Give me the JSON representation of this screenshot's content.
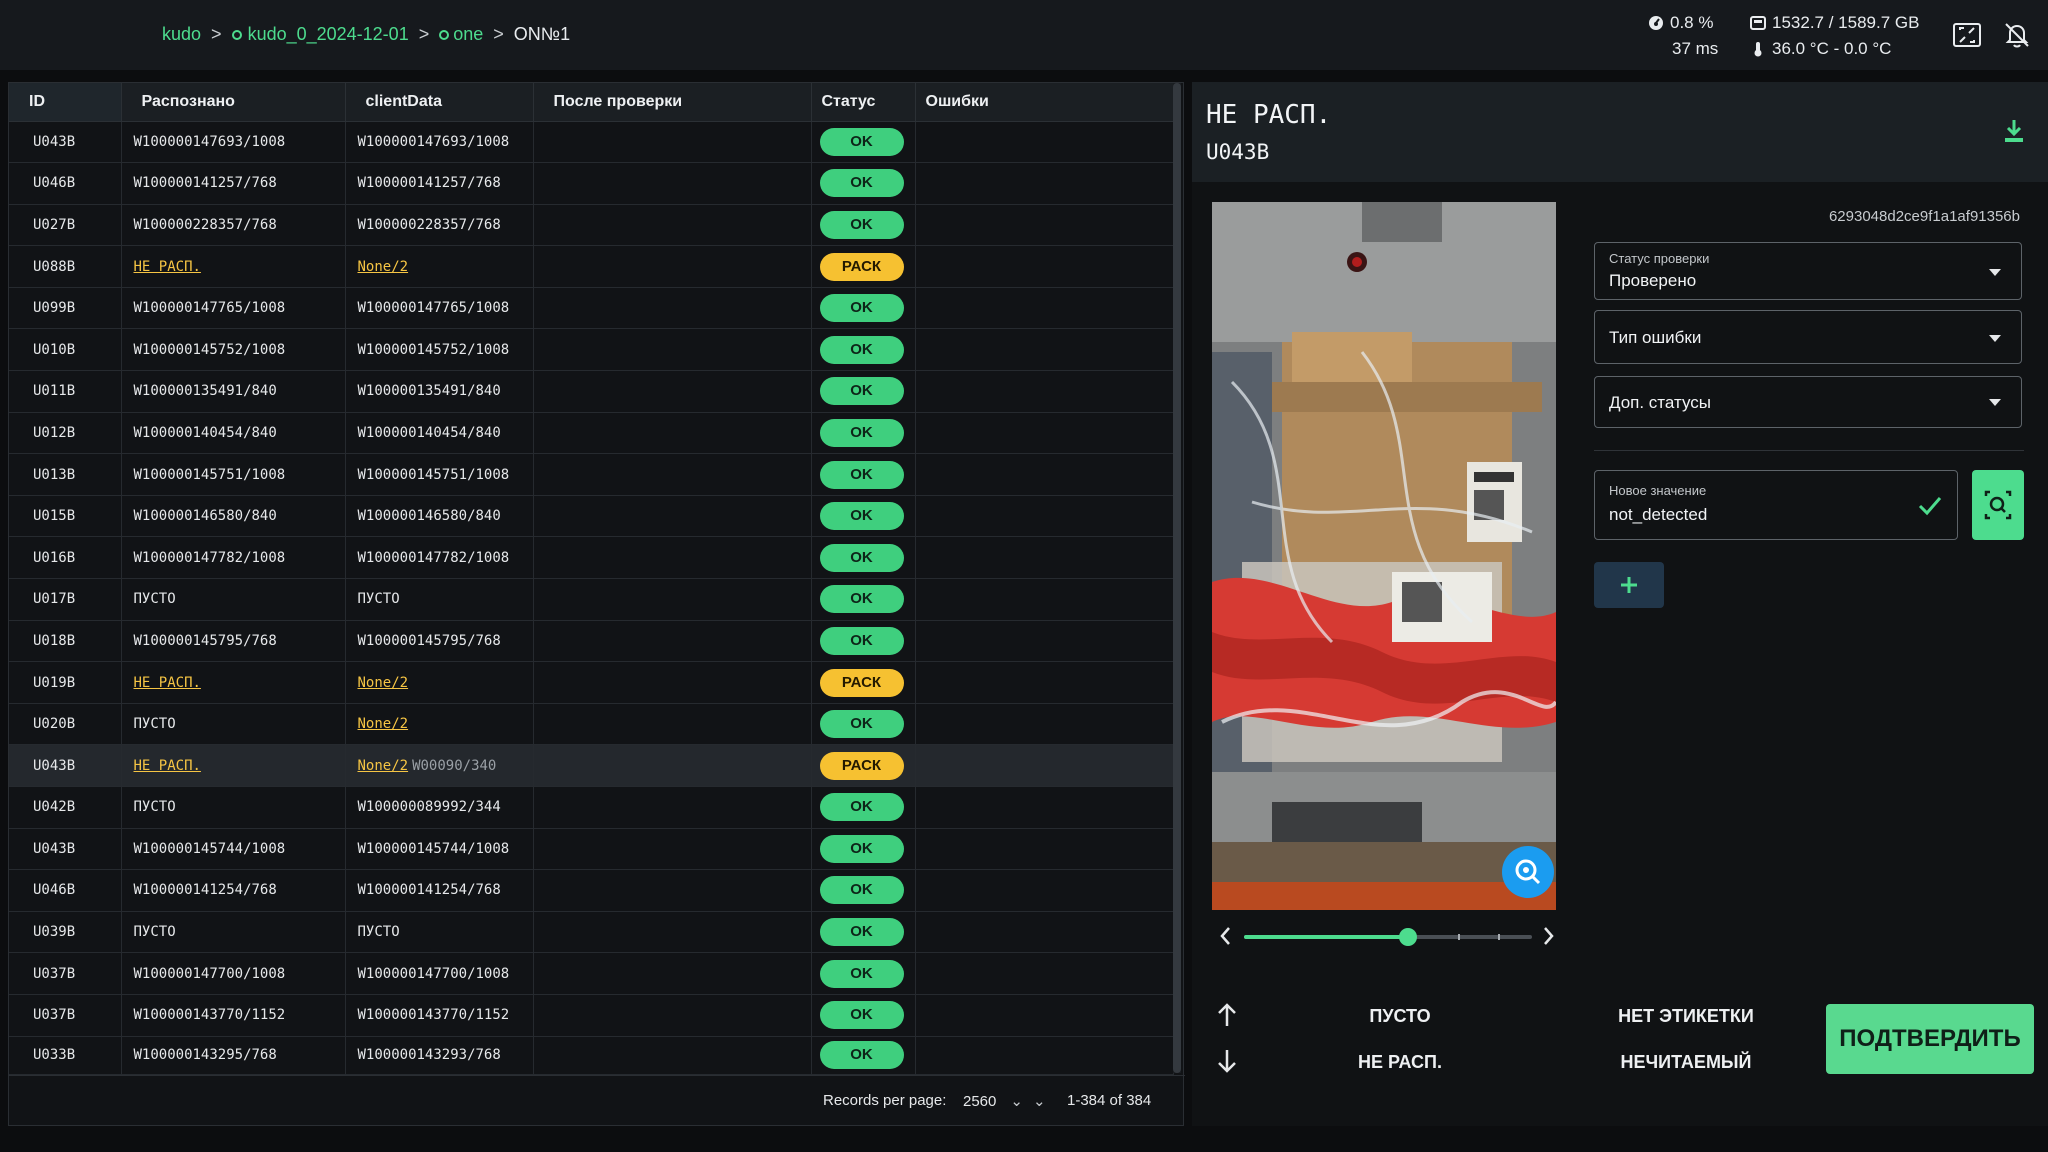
{
  "breadcrumb": {
    "root": "kudo",
    "dataset": "kudo_0_2024-12-01",
    "group": "one",
    "current": "ON№1",
    "sep": ">"
  },
  "stats": {
    "cpu": "0.8 %",
    "latency": "37 ms",
    "disk": "1532.7 / 1589.7 GB",
    "temperature": "36.0 °C - 0.0 °C"
  },
  "table": {
    "columns": [
      "ID",
      "Распознано",
      "clientData",
      "После проверки",
      "Статус",
      "Ошибки"
    ],
    "rows": [
      {
        "id": "U043B",
        "recognized": "W100000147693/1008",
        "client": "W100000147693/1008",
        "status": "OK"
      },
      {
        "id": "U046B",
        "recognized": "W100000141257/768",
        "client": "W100000141257/768",
        "status": "OK"
      },
      {
        "id": "U027B",
        "recognized": "W100000228357/768",
        "client": "W100000228357/768",
        "status": "OK"
      },
      {
        "id": "U088B",
        "recognized": "НЕ РАСП.",
        "client": "None/2",
        "status": "РАСК",
        "warn": true
      },
      {
        "id": "U099B",
        "recognized": "W100000147765/1008",
        "client": "W100000147765/1008",
        "status": "OK"
      },
      {
        "id": "U010B",
        "recognized": "W100000145752/1008",
        "client": "W100000145752/1008",
        "status": "OK"
      },
      {
        "id": "U011B",
        "recognized": "W100000135491/840",
        "client": "W100000135491/840",
        "status": "OK"
      },
      {
        "id": "U012B",
        "recognized": "W100000140454/840",
        "client": "W100000140454/840",
        "status": "OK"
      },
      {
        "id": "U013B",
        "recognized": "W100000145751/1008",
        "client": "W100000145751/1008",
        "status": "OK"
      },
      {
        "id": "U015B",
        "recognized": "W100000146580/840",
        "client": "W100000146580/840",
        "status": "OK"
      },
      {
        "id": "U016B",
        "recognized": "W100000147782/1008",
        "client": "W100000147782/1008",
        "status": "OK"
      },
      {
        "id": "U017B",
        "recognized": "ПУСТО",
        "client": "ПУСТО",
        "status": "OK"
      },
      {
        "id": "U018B",
        "recognized": "W100000145795/768",
        "client": "W100000145795/768",
        "status": "OK"
      },
      {
        "id": "U019B",
        "recognized": "НЕ РАСП.",
        "client": "None/2",
        "status": "РАСК",
        "warn": true
      },
      {
        "id": "U020B",
        "recognized": "ПУСТО",
        "client": "None/2",
        "status": "OK",
        "client_warn": true
      },
      {
        "id": "U043B",
        "recognized": "НЕ РАСП.",
        "client": "None/2",
        "client_extra": "W00090/340",
        "status": "РАСК",
        "warn": true,
        "selected": true
      },
      {
        "id": "U042B",
        "recognized": "ПУСТО",
        "client": "W100000089992/344",
        "status": "OK"
      },
      {
        "id": "U043B",
        "recognized": "W100000145744/1008",
        "client": "W100000145744/1008",
        "status": "OK"
      },
      {
        "id": "U046B",
        "recognized": "W100000141254/768",
        "client": "W100000141254/768",
        "status": "OK"
      },
      {
        "id": "U039B",
        "recognized": "ПУСТО",
        "client": "ПУСТО",
        "status": "OK"
      },
      {
        "id": "U037B",
        "recognized": "W100000147700/1008",
        "client": "W100000147700/1008",
        "status": "OK"
      },
      {
        "id": "U037B",
        "recognized": "W100000143770/1152",
        "client": "W100000143770/1152",
        "status": "OK"
      },
      {
        "id": "U033B",
        "recognized": "W100000143295/768",
        "client": "W100000143293/768",
        "status": "OK",
        "partial": true
      }
    ]
  },
  "pager": {
    "label": "Records per page:",
    "per_page": "2560",
    "range": "1-384 of 384"
  },
  "detail": {
    "title": "НЕ РАСП.",
    "subtitle": "U043B",
    "hash": "6293048d2ce9f1a1af91356b",
    "slider_fraction": 0.57,
    "status_field": {
      "label": "Статус проверки",
      "value": "Проверено"
    },
    "error_type": {
      "value": "Тип ошибки"
    },
    "extra_status": {
      "value": "Доп. статусы"
    },
    "new_value": {
      "label": "Новое значение",
      "value": "not_detected"
    },
    "actions": {
      "empty": "ПУСТО",
      "no_label": "НЕТ ЭТИКЕТКИ",
      "not_recognized": "НЕ РАСП.",
      "unreadable": "НЕЧИТАЕМЫЙ",
      "confirm": "ПОДТВЕРДИТЬ"
    }
  },
  "colors": {
    "accent": "#4ddc8e",
    "ok": "#3fcf7e",
    "warn": "#f6c131",
    "zoom": "#1b9cf0"
  }
}
